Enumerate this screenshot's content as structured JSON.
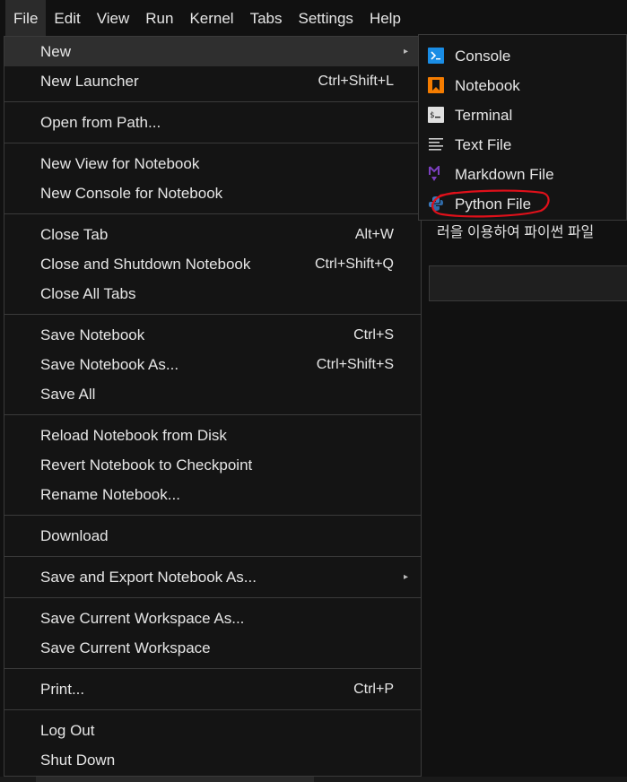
{
  "menubar": {
    "items": [
      {
        "label": "File",
        "active": true
      },
      {
        "label": "Edit"
      },
      {
        "label": "View"
      },
      {
        "label": "Run"
      },
      {
        "label": "Kernel"
      },
      {
        "label": "Tabs"
      },
      {
        "label": "Settings"
      },
      {
        "label": "Help"
      }
    ]
  },
  "file_menu": {
    "new": {
      "label": "New",
      "submenu_icon": "chevron-right-icon"
    },
    "new_launcher": {
      "label": "New Launcher",
      "shortcut": "Ctrl+Shift+L"
    },
    "open_from_path": {
      "label": "Open from Path..."
    },
    "new_view_for_notebook": {
      "label": "New View for Notebook"
    },
    "new_console_for_notebook": {
      "label": "New Console for Notebook"
    },
    "close_tab": {
      "label": "Close Tab",
      "shortcut": "Alt+W"
    },
    "close_and_shutdown": {
      "label": "Close and Shutdown Notebook",
      "shortcut": "Ctrl+Shift+Q"
    },
    "close_all_tabs": {
      "label": "Close All Tabs"
    },
    "save_notebook": {
      "label": "Save Notebook",
      "shortcut": "Ctrl+S"
    },
    "save_notebook_as": {
      "label": "Save Notebook As...",
      "shortcut": "Ctrl+Shift+S"
    },
    "save_all": {
      "label": "Save All"
    },
    "reload_from_disk": {
      "label": "Reload Notebook from Disk"
    },
    "revert_to_checkpoint": {
      "label": "Revert Notebook to Checkpoint"
    },
    "rename_notebook": {
      "label": "Rename Notebook..."
    },
    "download": {
      "label": "Download"
    },
    "save_and_export": {
      "label": "Save and Export Notebook As...",
      "submenu_icon": "chevron-right-icon"
    },
    "save_workspace_as": {
      "label": "Save Current Workspace As..."
    },
    "save_workspace": {
      "label": "Save Current Workspace"
    },
    "print": {
      "label": "Print...",
      "shortcut": "Ctrl+P"
    },
    "log_out": {
      "label": "Log Out"
    },
    "shut_down": {
      "label": "Shut Down"
    }
  },
  "new_submenu": {
    "items": [
      {
        "label": "Console",
        "icon": "console-icon",
        "icon_color": "#1a8de5"
      },
      {
        "label": "Notebook",
        "icon": "notebook-icon",
        "icon_color": "#f57c00"
      },
      {
        "label": "Terminal",
        "icon": "terminal-icon",
        "icon_color": "#e0e0e0"
      },
      {
        "label": "Text File",
        "icon": "text-file-icon",
        "icon_color": "#cccccc"
      },
      {
        "label": "Markdown File",
        "icon": "markdown-icon",
        "icon_color": "#7b3fbf"
      },
      {
        "label": "Python File",
        "icon": "python-icon",
        "icon_color": "#3572a5",
        "annotated": true
      }
    ]
  },
  "background": {
    "notebook_text": "러을 이용하여 파이썬 파일"
  },
  "annotation_color": "#e0101a"
}
